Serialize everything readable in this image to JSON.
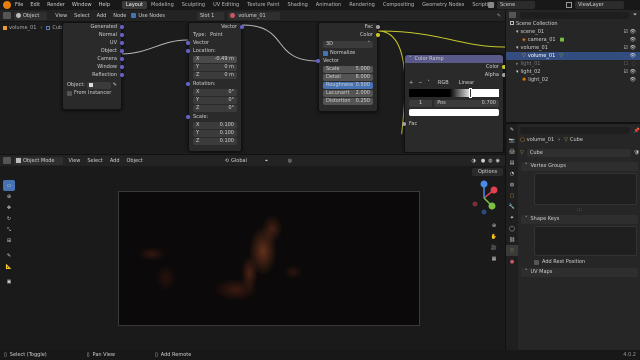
{
  "topbar": {
    "menus": [
      "File",
      "Edit",
      "Render",
      "Window",
      "Help"
    ],
    "workspaces": [
      "Layout",
      "Modeling",
      "Sculpting",
      "UV Editing",
      "Texture Paint",
      "Shading",
      "Animation",
      "Rendering",
      "Compositing",
      "Geometry Nodes",
      "Scripting"
    ],
    "active_workspace": "Layout",
    "scene": "Scene",
    "view_layer": "ViewLayer"
  },
  "node_header": {
    "object_label": "Object",
    "menus": [
      "View",
      "Select",
      "Add",
      "Node"
    ],
    "use_nodes": "Use Nodes",
    "slot": "Slot 1",
    "material": "volume_01",
    "breadcrumb_obj": "volume_01",
    "breadcrumb_mesh": "Cube"
  },
  "texcoord_node": {
    "outputs": [
      "Generated",
      "Normal",
      "UV",
      "Object",
      "Camera",
      "Window",
      "Reflection"
    ],
    "object_field": "Object:",
    "from_instancer": "From Instancer"
  },
  "mapping_node": {
    "out": "Vector",
    "type_label": "Type:",
    "type_value": "Point",
    "vector": "Vector",
    "location": "Location:",
    "loc": [
      [
        "X",
        "-0.49 m"
      ],
      [
        "Y",
        "0 m"
      ],
      [
        "Z",
        "0 m"
      ]
    ],
    "rotation": "Rotation:",
    "rot": [
      [
        "X",
        "0°"
      ],
      [
        "Y",
        "0°"
      ],
      [
        "Z",
        "0°"
      ]
    ],
    "scale": "Scale:",
    "scl": [
      [
        "X",
        "0.100"
      ],
      [
        "Y",
        "0.100"
      ],
      [
        "Z",
        "0.100"
      ]
    ]
  },
  "noise_node": {
    "fac": "Fac",
    "color": "Color",
    "dim": "3D",
    "normalize": "Normalize",
    "vector": "Vector",
    "params": [
      [
        "Scale",
        "5.000"
      ],
      [
        "Detail",
        "8.000"
      ],
      [
        "Roughness",
        "0.500"
      ],
      [
        "Lacunarit",
        "2.000"
      ],
      [
        "Distortion",
        "0.250"
      ]
    ]
  },
  "ramp_node": {
    "title": "Color Ramp",
    "color": "Color",
    "alpha": "Alpha",
    "mode": "RGB",
    "interp": "Linear",
    "index": "1",
    "pos_label": "Pos",
    "pos_value": "0.700",
    "fac": "Fac"
  },
  "outliner": {
    "rows": [
      {
        "label": "Scene Collection",
        "indent": 0
      },
      {
        "label": "scene_01",
        "indent": 1
      },
      {
        "label": "camera_01",
        "indent": 2
      },
      {
        "label": "volume_01",
        "indent": 1
      },
      {
        "label": "volume_01",
        "indent": 2
      },
      {
        "label": "light_01",
        "indent": 1
      },
      {
        "label": "light_02",
        "indent": 1
      },
      {
        "label": "light_02",
        "indent": 2
      }
    ]
  },
  "properties": {
    "obj": "volume_01",
    "mesh": "Cube",
    "data_name": "Cube",
    "sections": [
      "Vertex Groups",
      "Shape Keys",
      "UV Maps"
    ],
    "add_rest": "Add Rest Position"
  },
  "viewport_header": {
    "mode": "Object Mode",
    "menus": [
      "View",
      "Select",
      "Add",
      "Object"
    ],
    "orientation": "Global",
    "options": "Options"
  },
  "statusbar": {
    "left": "Select (Toggle)",
    "mid": "Pan View",
    "right_action": "Add Remote",
    "version": "4.0.2"
  },
  "colors": {
    "accent": "#4772b3",
    "selected": "#334d80",
    "socket_vector": "#6363c7",
    "socket_color": "#c7c729",
    "socket_float": "#a1a1a1"
  }
}
